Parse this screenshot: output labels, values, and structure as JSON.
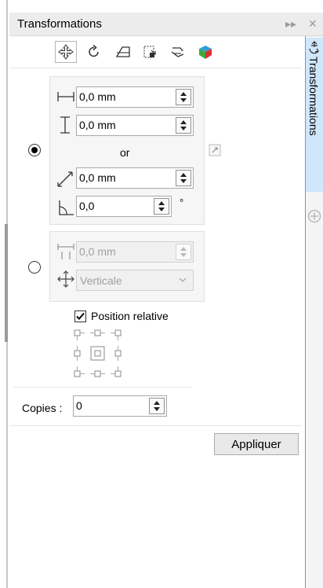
{
  "panel": {
    "title": "Transformations",
    "side_tab_label": "Transformations"
  },
  "toolbar": {
    "icons": [
      "position-icon",
      "rotate-icon",
      "scale-mirror-icon",
      "size-icon",
      "skew-icon",
      "color-cube-icon"
    ]
  },
  "position": {
    "x_value": "0,0 mm",
    "y_value": "0,0 mm",
    "or_label": "or",
    "distance_value": "0,0 mm",
    "angle_value": "0,0",
    "angle_unit": "°"
  },
  "alternate": {
    "distance_value": "0,0 mm",
    "direction_value": "Verticale"
  },
  "relative": {
    "label": "Position relative",
    "checked": true
  },
  "copies": {
    "label": "Copies :",
    "value": "0"
  },
  "apply_label": "Appliquer",
  "colors": {
    "accent": "#4aa3e8",
    "tab_bg": "#cfe6fb"
  }
}
